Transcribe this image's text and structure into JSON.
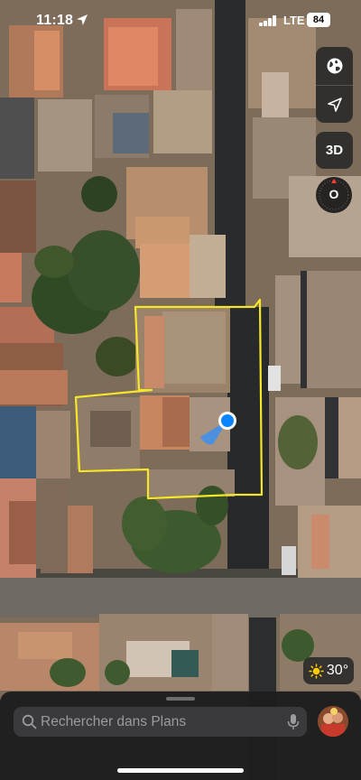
{
  "status_bar": {
    "time": "11:18",
    "network": "LTE",
    "battery": "84"
  },
  "map_controls": {
    "map_mode_icon": "globe-icon",
    "location_icon": "location-arrow-icon",
    "view_3d_label": "3D",
    "compass_letter": "O"
  },
  "map": {
    "type": "satellite",
    "annotation_color": "#f5e62a",
    "user_location_color": "#0a84ff"
  },
  "weather": {
    "icon": "sun-icon",
    "temperature": "30°"
  },
  "search": {
    "placeholder": "Rechercher dans Plans",
    "icon": "search-icon",
    "mic_icon": "microphone-icon"
  },
  "account": {
    "icon": "avatar"
  }
}
